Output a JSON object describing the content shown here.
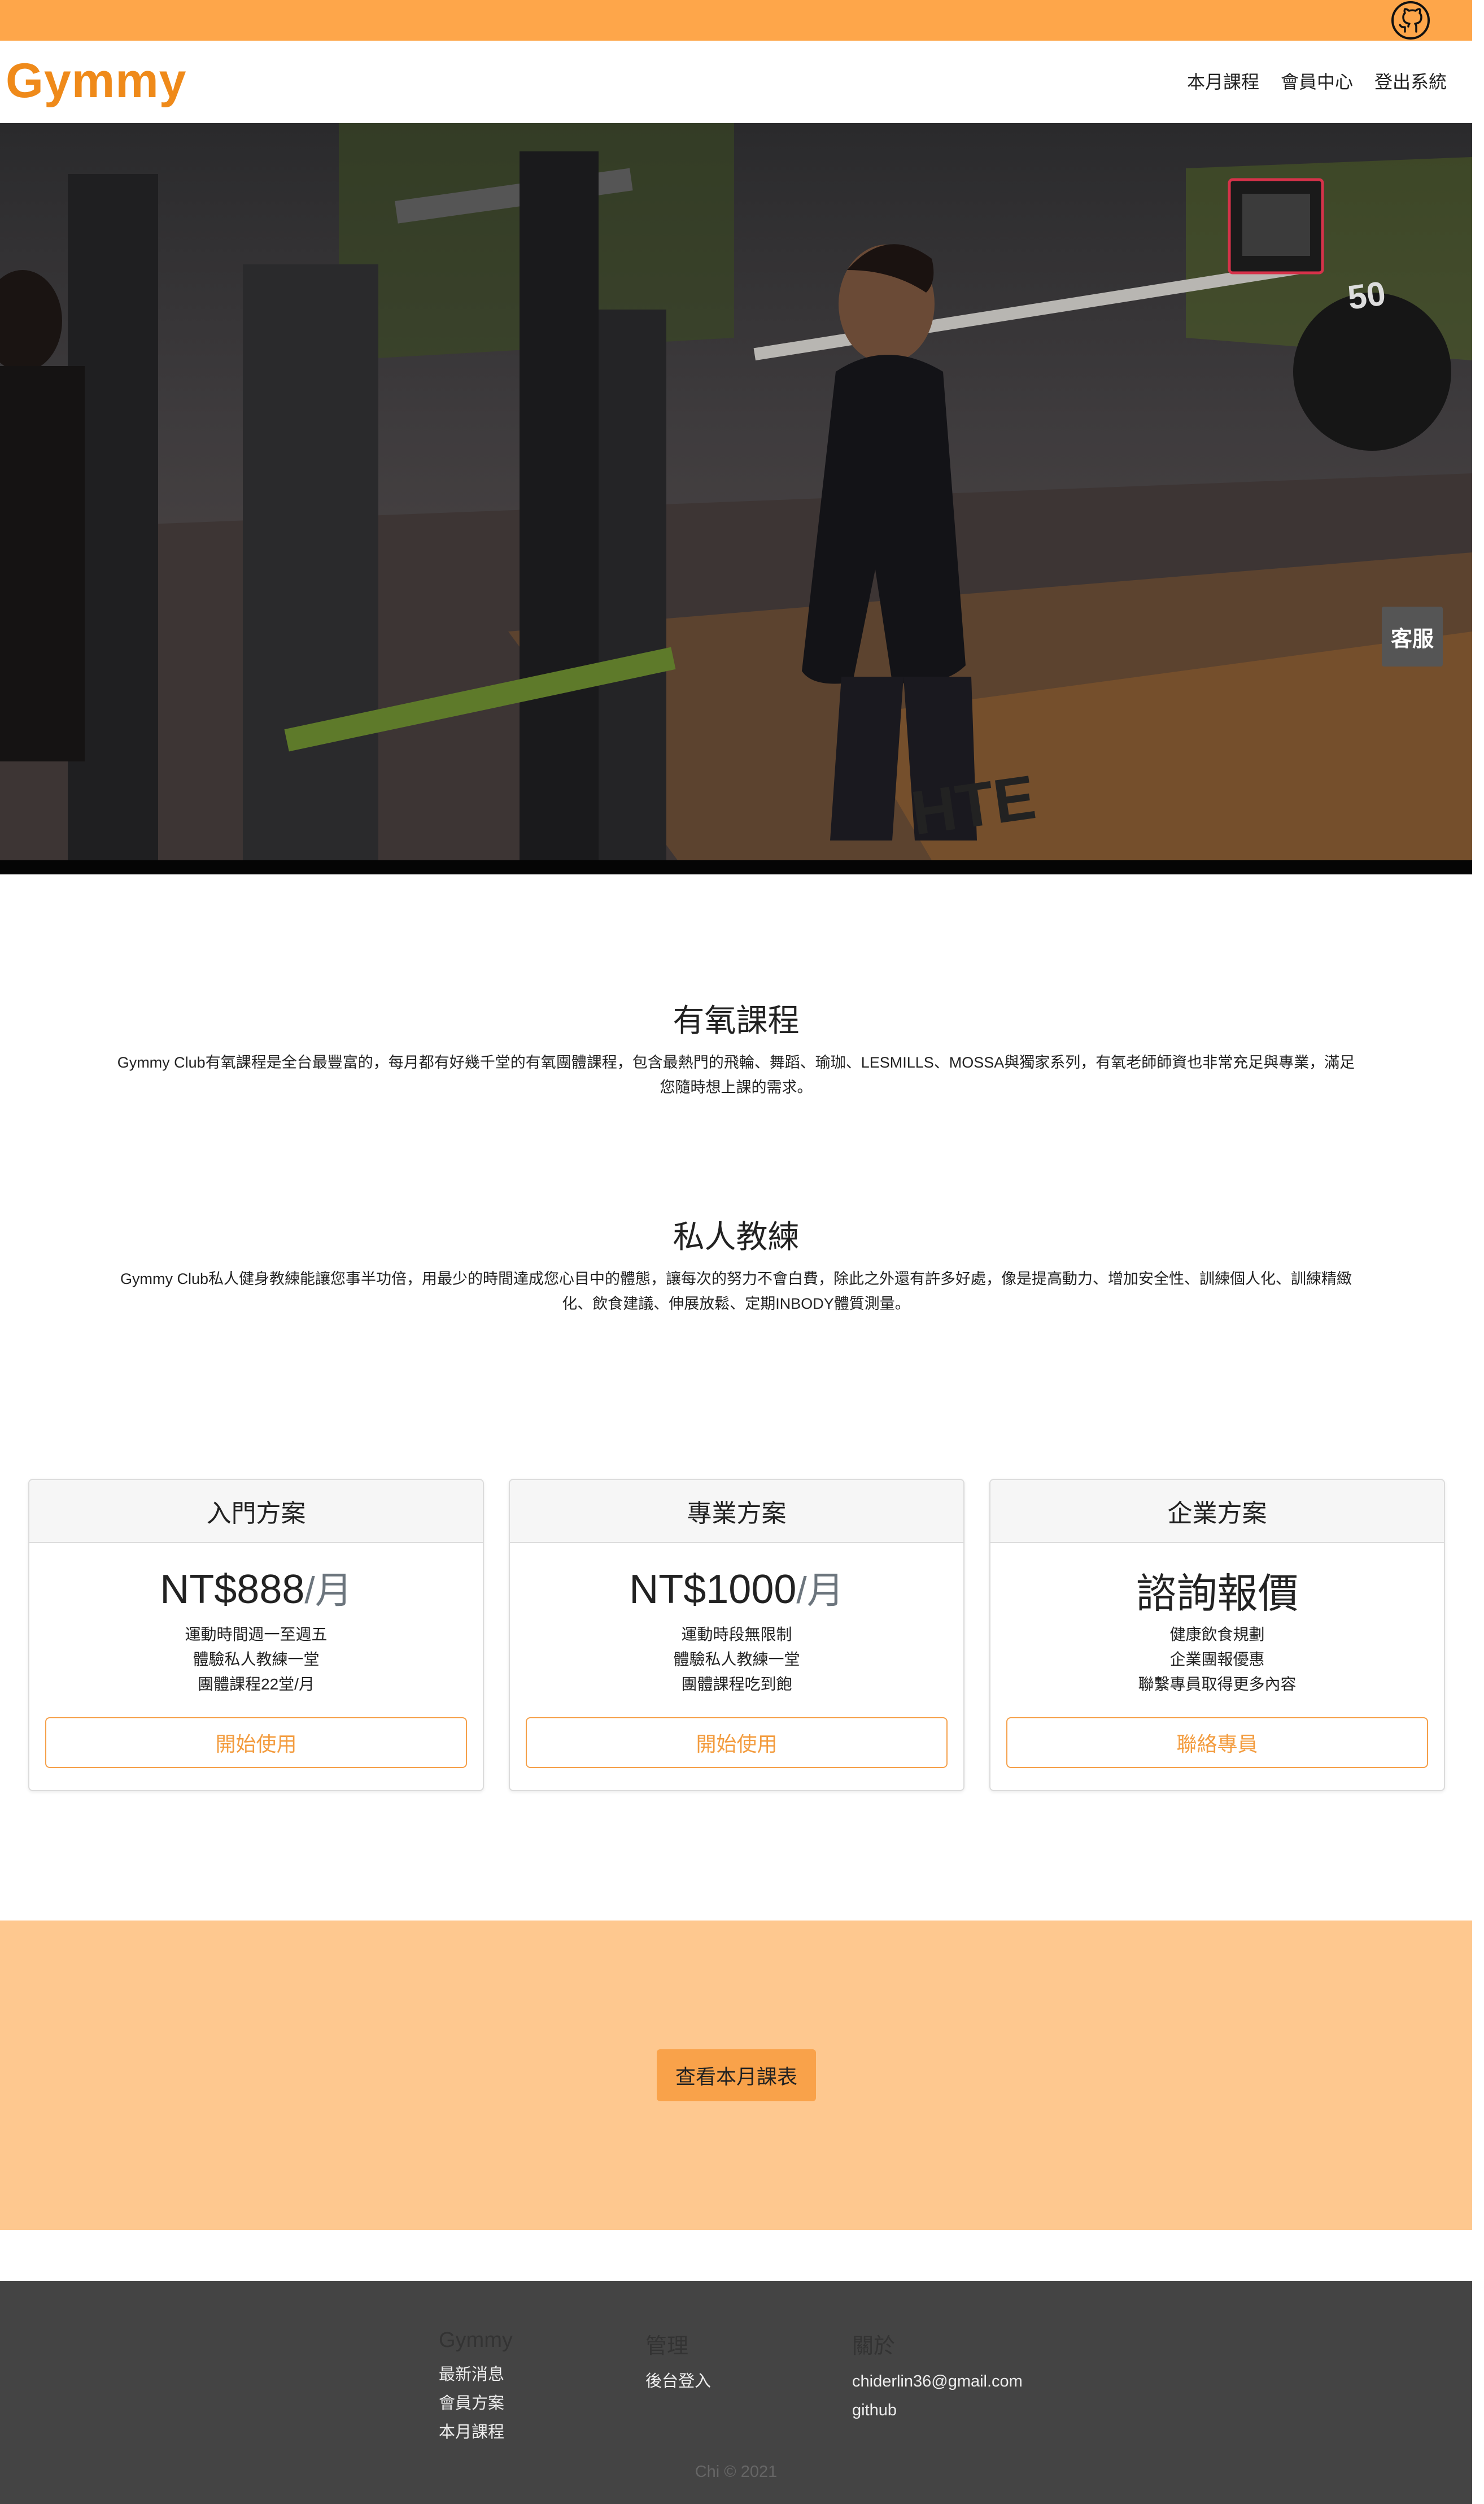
{
  "brand": {
    "name": "Gymmy",
    "color": "#ef8a1a",
    "topbar_color": "#fea64a"
  },
  "topbar": {
    "icon": "github-icon"
  },
  "nav": {
    "items": [
      "本月課程",
      "會員中心",
      "登出系統"
    ]
  },
  "hero": {
    "customer_service_label": "客服",
    "media": "gym workout video of woman squatting with barbell"
  },
  "features": [
    {
      "title": "有氧課程",
      "text": "Gymmy Club有氧課程是全台最豐富的，每月都有好幾千堂的有氧團體課程，包含最熱門的飛輪、舞蹈、瑜珈、LESMILLS、MOSSA與獨家系列，有氧老師師資也非常充足與專業，滿足您隨時想上課的需求。"
    },
    {
      "title": "私人教練",
      "text": "Gymmy Club私人健身教練能讓您事半功倍，用最少的時間達成您心目中的體態，讓每次的努力不會白費，除此之外還有許多好處，像是提高動力、增加安全性、訓練個人化、訓練精緻化、飲食建議、伸展放鬆、定期INBODY體質測量。"
    }
  ],
  "plans": [
    {
      "name": "入門方案",
      "price": "NT$888",
      "per": "/月",
      "features": [
        "運動時間週一至週五",
        "體驗私人教練一堂",
        "團體課程22堂/月"
      ],
      "button": "開始使用"
    },
    {
      "name": "專業方案",
      "price": "NT$1000",
      "per": "/月",
      "features": [
        "運動時段無限制",
        "體驗私人教練一堂",
        "團體課程吃到飽"
      ],
      "button": "開始使用"
    },
    {
      "name": "企業方案",
      "price": "諮詢報價",
      "per": "",
      "features": [
        "健康飲食規劃",
        "企業團報優惠",
        "聯繫專員取得更多內容"
      ],
      "button": "聯絡專員"
    }
  ],
  "cta": {
    "label": "查看本月課表",
    "band_color": "#fec88f",
    "button_color": "#f9a24a"
  },
  "footer": {
    "columns": [
      {
        "title": "Gymmy",
        "links": [
          "最新消息",
          "會員方案",
          "本月課程"
        ]
      },
      {
        "title": "管理",
        "links": [
          "後台登入"
        ]
      },
      {
        "title": "關於",
        "links": [
          "chiderlin36@gmail.com",
          "github"
        ]
      }
    ],
    "copyright": "Chi © 2021"
  }
}
